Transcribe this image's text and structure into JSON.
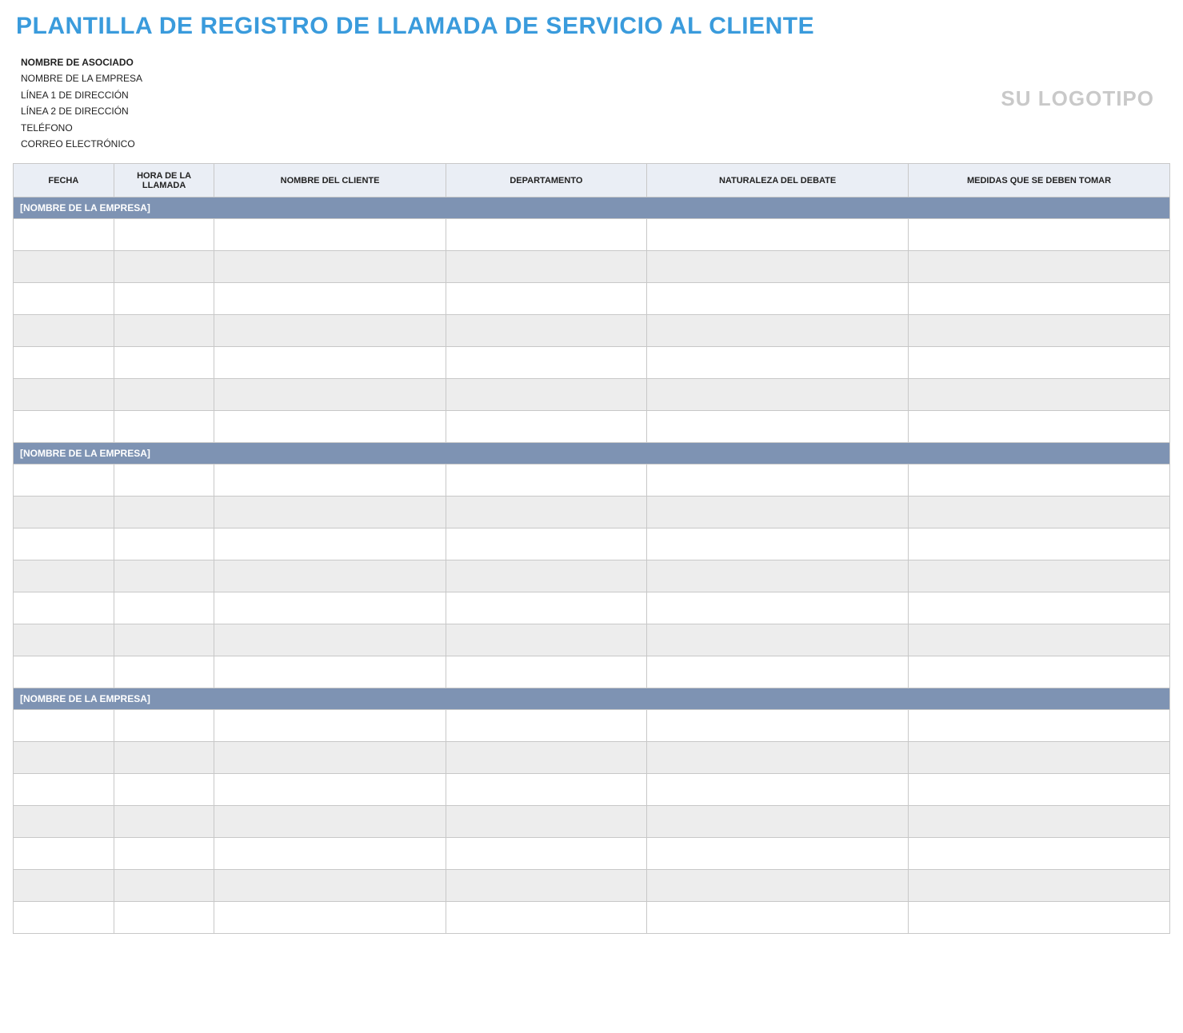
{
  "title": "PLANTILLA DE REGISTRO DE LLAMADA DE SERVICIO AL CLIENTE",
  "associate": {
    "name_label": "NOMBRE DE ASOCIADO",
    "company": "NOMBRE DE LA EMPRESA",
    "address1": "LÍNEA 1 DE DIRECCIÓN",
    "address2": "LÍNEA 2 DE DIRECCIÓN",
    "phone": "TELÉFONO",
    "email": "CORREO ELECTRÓNICO"
  },
  "logo_text": "SU LOGOTIPO",
  "columns": {
    "fecha": "FECHA",
    "hora": "HORA DE LA LLAMADA",
    "cliente": "NOMBRE DEL CLIENTE",
    "departamento": "DEPARTAMENTO",
    "naturaleza": "NATURALEZA DEL DEBATE",
    "medidas": "MEDIDAS QUE SE DEBEN TOMAR"
  },
  "sections": [
    {
      "label": "[NOMBRE DE LA EMPRESA]",
      "rows": [
        {
          "fecha": "",
          "hora": "",
          "cliente": "",
          "departamento": "",
          "naturaleza": "",
          "medidas": ""
        },
        {
          "fecha": "",
          "hora": "",
          "cliente": "",
          "departamento": "",
          "naturaleza": "",
          "medidas": ""
        },
        {
          "fecha": "",
          "hora": "",
          "cliente": "",
          "departamento": "",
          "naturaleza": "",
          "medidas": ""
        },
        {
          "fecha": "",
          "hora": "",
          "cliente": "",
          "departamento": "",
          "naturaleza": "",
          "medidas": ""
        },
        {
          "fecha": "",
          "hora": "",
          "cliente": "",
          "departamento": "",
          "naturaleza": "",
          "medidas": ""
        },
        {
          "fecha": "",
          "hora": "",
          "cliente": "",
          "departamento": "",
          "naturaleza": "",
          "medidas": ""
        },
        {
          "fecha": "",
          "hora": "",
          "cliente": "",
          "departamento": "",
          "naturaleza": "",
          "medidas": ""
        }
      ]
    },
    {
      "label": "[NOMBRE DE LA EMPRESA]",
      "rows": [
        {
          "fecha": "",
          "hora": "",
          "cliente": "",
          "departamento": "",
          "naturaleza": "",
          "medidas": ""
        },
        {
          "fecha": "",
          "hora": "",
          "cliente": "",
          "departamento": "",
          "naturaleza": "",
          "medidas": ""
        },
        {
          "fecha": "",
          "hora": "",
          "cliente": "",
          "departamento": "",
          "naturaleza": "",
          "medidas": ""
        },
        {
          "fecha": "",
          "hora": "",
          "cliente": "",
          "departamento": "",
          "naturaleza": "",
          "medidas": ""
        },
        {
          "fecha": "",
          "hora": "",
          "cliente": "",
          "departamento": "",
          "naturaleza": "",
          "medidas": ""
        },
        {
          "fecha": "",
          "hora": "",
          "cliente": "",
          "departamento": "",
          "naturaleza": "",
          "medidas": ""
        },
        {
          "fecha": "",
          "hora": "",
          "cliente": "",
          "departamento": "",
          "naturaleza": "",
          "medidas": ""
        }
      ]
    },
    {
      "label": "[NOMBRE DE LA EMPRESA]",
      "rows": [
        {
          "fecha": "",
          "hora": "",
          "cliente": "",
          "departamento": "",
          "naturaleza": "",
          "medidas": ""
        },
        {
          "fecha": "",
          "hora": "",
          "cliente": "",
          "departamento": "",
          "naturaleza": "",
          "medidas": ""
        },
        {
          "fecha": "",
          "hora": "",
          "cliente": "",
          "departamento": "",
          "naturaleza": "",
          "medidas": ""
        },
        {
          "fecha": "",
          "hora": "",
          "cliente": "",
          "departamento": "",
          "naturaleza": "",
          "medidas": ""
        },
        {
          "fecha": "",
          "hora": "",
          "cliente": "",
          "departamento": "",
          "naturaleza": "",
          "medidas": ""
        },
        {
          "fecha": "",
          "hora": "",
          "cliente": "",
          "departamento": "",
          "naturaleza": "",
          "medidas": ""
        },
        {
          "fecha": "",
          "hora": "",
          "cliente": "",
          "departamento": "",
          "naturaleza": "",
          "medidas": ""
        }
      ]
    }
  ]
}
